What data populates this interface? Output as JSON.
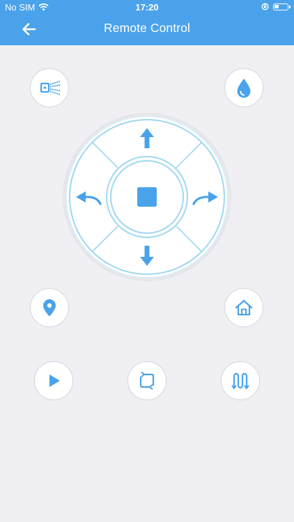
{
  "status_bar": {
    "carrier": "No SIM",
    "time": "17:20"
  },
  "header": {
    "title": "Remote Control"
  },
  "icons": {
    "back": "back-arrow-icon",
    "spray": "spray-icon",
    "water": "water-drop-icon",
    "locate": "location-pin-icon",
    "home": "home-icon",
    "play": "play-icon",
    "edge": "edge-cleaning-icon",
    "zigzag": "zigzag-cleaning-icon",
    "stop": "stop-icon",
    "forward": "arrow-up-icon",
    "backward": "arrow-down-icon",
    "turn_left": "turn-left-icon",
    "turn_right": "turn-right-icon"
  },
  "colors": {
    "header": "#4aa3ea",
    "accent": "#4aa3ea",
    "ring": "#9fd8ef",
    "background": "#efeff4"
  }
}
